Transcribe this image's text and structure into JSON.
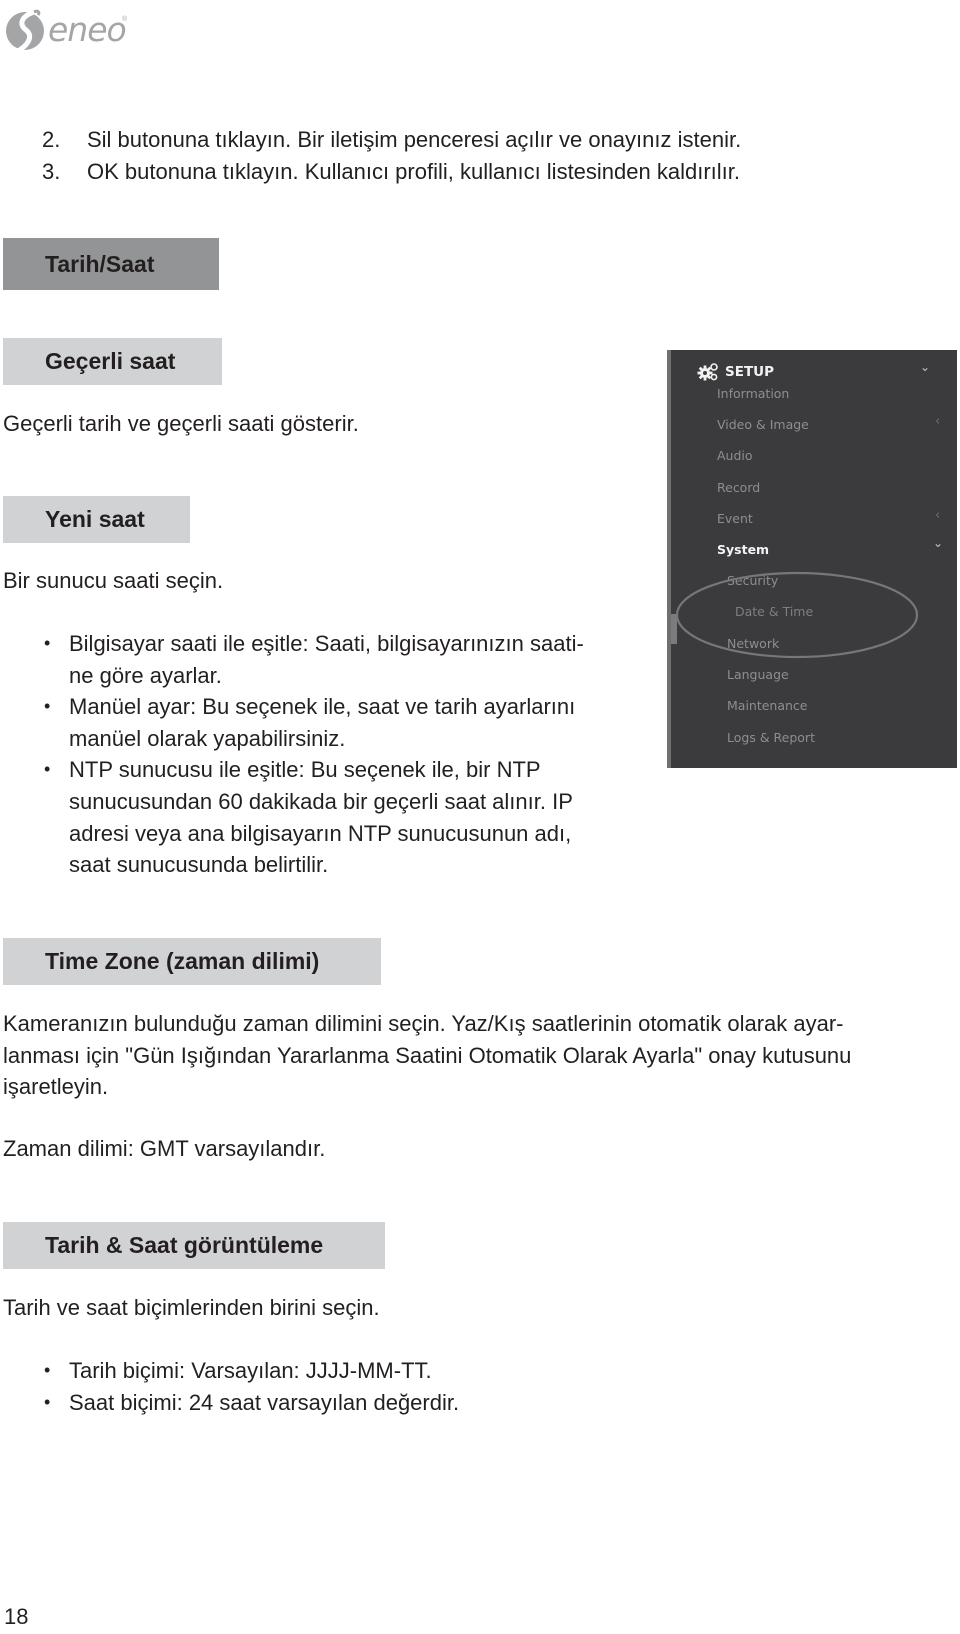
{
  "header": {
    "logo_text": "eneo",
    "logo_mark": "®"
  },
  "steps": [
    {
      "number": "2.",
      "text": "Sil butonuna tıklayın. Bir iletişim penceresi açılır ve onayınız istenir."
    },
    {
      "number": "3.",
      "text": "OK butonuna tıklayın. Kullanıcı profili, kullanıcı listesinden kaldırılır."
    }
  ],
  "section_main": {
    "title": "Tarih/Saat"
  },
  "section_current": {
    "title": "Geçerli saat",
    "body": "Geçerli tarih ve geçerli saati gösterir."
  },
  "section_new": {
    "title": "Yeni saat",
    "body": "Bir sunucu saati seçin.",
    "bullets": [
      {
        "lines": [
          "Bilgisayar saati ile eşitle: Saati, bilgisayarınızın saati-",
          "ne göre ayarlar."
        ]
      },
      {
        "lines": [
          "Manüel ayar: Bu seçenek ile, saat ve tarih ayarlarını",
          "manüel olarak yapabilirsiniz."
        ]
      },
      {
        "lines": [
          "NTP sunucusu ile eşitle: Bu seçenek ile, bir NTP",
          "sunucusundan 60 dakikada bir geçerli saat alınır. IP",
          "adresi veya ana bilgisayarın NTP sunucusunun adı,",
          "saat sunucusunda belirtilir."
        ]
      }
    ]
  },
  "setup_menu": {
    "title": "SETUP",
    "items": [
      {
        "label": "Information",
        "chevron": ""
      },
      {
        "label": "Video & Image",
        "chevron": "‹"
      },
      {
        "label": "Audio",
        "chevron": ""
      },
      {
        "label": "Record",
        "chevron": ""
      },
      {
        "label": "Event",
        "chevron": "‹"
      },
      {
        "label": "System",
        "chevron": "⌄",
        "active": true
      }
    ],
    "sub_items": [
      {
        "label": "Security"
      },
      {
        "label": "Date & Time",
        "selected": true
      },
      {
        "label": "Network"
      },
      {
        "label": "Language"
      },
      {
        "label": "Maintenance"
      },
      {
        "label": "Logs & Report"
      }
    ],
    "colors": {
      "background": "#3b3a3c",
      "text": "#8e8d8f",
      "active": "#f4f4f4"
    }
  },
  "section_timezone": {
    "title": "Time Zone (zaman dilimi)",
    "body_lines": [
      "Kameranızın bulunduğu zaman dilimini seçin. Yaz/Kış saatlerinin otomatik olarak ayar-",
      "lanması için \"Gün Işığından Yararlanma Saatini Otomatik Olarak Ayarla\" onay kutusunu",
      "işaretleyin."
    ],
    "default_note": "Zaman dilimi: GMT varsayılandır."
  },
  "section_display": {
    "title": "Tarih & Saat görüntüleme",
    "body": "Tarih ve saat biçimlerinden birini seçin.",
    "bullets": [
      {
        "lines": [
          "Tarih biçimi: Varsayılan: JJJJ-MM-TT."
        ]
      },
      {
        "lines": [
          "Saat biçimi: 24 saat varsayılan değerdir."
        ]
      }
    ]
  },
  "footer": {
    "page_number": "18"
  }
}
